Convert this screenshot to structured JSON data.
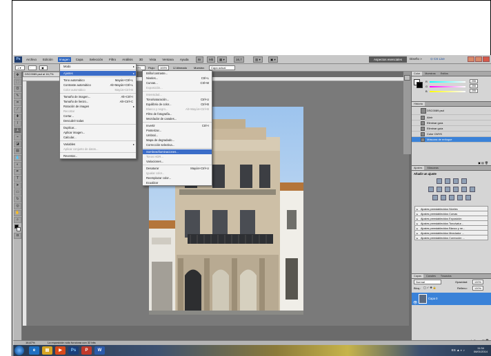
{
  "app": {
    "logo_text": "Ps",
    "menu": [
      "Archivo",
      "Edición",
      "Imagen",
      "Capa",
      "Selección",
      "Filtro",
      "Análisis",
      "3D",
      "Vista",
      "Ventana",
      "Ayuda"
    ],
    "active_menu": "Imagen",
    "zoom_box": "16,7",
    "workspace_button": "Aspectos esenciales",
    "workspace_design": "Diseño",
    "more": "»",
    "cslive": "CS Live"
  },
  "options": {
    "zoom_field": "100%",
    "flujo_label": "Flujo:",
    "flujo_value": "100%",
    "alinear_label": "Alineado",
    "muestra_label": "Muestra:",
    "muestra_value": "Capa actual"
  },
  "doc": {
    "tab": "DSC0089.psd al 16,7%"
  },
  "imagen_menu": {
    "items": [
      {
        "label": "Modo",
        "shortcut": "",
        "arrow": true,
        "disabled": false,
        "sep_after": true
      },
      {
        "label": "Ajustes",
        "shortcut": "",
        "arrow": true,
        "disabled": false,
        "highlight": true,
        "sep_after": true
      },
      {
        "label": "Tono automático",
        "shortcut": "Mayús+Ctrl+L",
        "disabled": false
      },
      {
        "label": "Contraste automático",
        "shortcut": "Alt+Mayús+Ctrl+L",
        "disabled": false
      },
      {
        "label": "Color automático",
        "shortcut": "Mayús+Ctrl+B",
        "disabled": true,
        "sep_after": true
      },
      {
        "label": "Tamaño de imagen...",
        "shortcut": "Alt+Ctrl+I",
        "disabled": false
      },
      {
        "label": "Tamaño de lienzo...",
        "shortcut": "Alt+Ctrl+C",
        "disabled": false
      },
      {
        "label": "Rotación de imagen",
        "shortcut": "",
        "arrow": true,
        "disabled": false
      },
      {
        "label": "Recortar",
        "shortcut": "",
        "disabled": true
      },
      {
        "label": "Cortar...",
        "shortcut": "",
        "disabled": false
      },
      {
        "label": "Descubrir todas",
        "shortcut": "",
        "disabled": false,
        "sep_after": true
      },
      {
        "label": "Duplicar...",
        "shortcut": "",
        "disabled": false
      },
      {
        "label": "Aplicar imagen...",
        "shortcut": "",
        "disabled": false
      },
      {
        "label": "Calcular...",
        "shortcut": "",
        "disabled": false,
        "sep_after": true
      },
      {
        "label": "Variables",
        "shortcut": "",
        "arrow": true,
        "disabled": false
      },
      {
        "label": "Aplicar conjunto de datos...",
        "shortcut": "",
        "disabled": true,
        "sep_after": true
      },
      {
        "label": "Reventar...",
        "shortcut": "",
        "disabled": false
      }
    ]
  },
  "ajustes_menu": {
    "items": [
      {
        "label": "Brillo/contraste...",
        "shortcut": "",
        "disabled": false
      },
      {
        "label": "Niveles...",
        "shortcut": "Ctrl+L",
        "disabled": false
      },
      {
        "label": "Curvas...",
        "shortcut": "Ctrl+M",
        "disabled": false
      },
      {
        "label": "Exposición...",
        "shortcut": "",
        "disabled": true,
        "sep_after": true
      },
      {
        "label": "Intensidad...",
        "shortcut": "",
        "disabled": true
      },
      {
        "label": "Tono/saturación...",
        "shortcut": "Ctrl+U",
        "disabled": false
      },
      {
        "label": "Equilibrio de color...",
        "shortcut": "Ctrl+B",
        "disabled": false
      },
      {
        "label": "Blanco y negro...",
        "shortcut": "Alt+Mayús+Ctrl+B",
        "disabled": true
      },
      {
        "label": "Filtro de fotografía...",
        "shortcut": "",
        "disabled": false
      },
      {
        "label": "Mezclador de canales...",
        "shortcut": "",
        "disabled": false,
        "sep_after": true
      },
      {
        "label": "Invertir",
        "shortcut": "Ctrl+I",
        "disabled": false
      },
      {
        "label": "Posterizar...",
        "shortcut": "",
        "disabled": false
      },
      {
        "label": "Umbral...",
        "shortcut": "",
        "disabled": false
      },
      {
        "label": "Mapa de degradado...",
        "shortcut": "",
        "disabled": false
      },
      {
        "label": "Corrección selectiva...",
        "shortcut": "",
        "disabled": false,
        "sep_after": true
      },
      {
        "label": "Sombras/iluminaciones...",
        "shortcut": "",
        "disabled": false,
        "highlight": true
      },
      {
        "label": "Tonos HDR...",
        "shortcut": "",
        "disabled": true
      },
      {
        "label": "Variaciones...",
        "shortcut": "",
        "disabled": false,
        "sep_after": true
      },
      {
        "label": "Desaturar",
        "shortcut": "Mayús+Ctrl+U",
        "disabled": false
      },
      {
        "label": "Igualar color...",
        "shortcut": "",
        "disabled": true
      },
      {
        "label": "Reemplazar color...",
        "shortcut": "",
        "disabled": false
      },
      {
        "label": "Ecualizar",
        "shortcut": "",
        "disabled": false
      }
    ]
  },
  "color_panel": {
    "tabs": [
      "Color",
      "Muestras",
      "Estilos"
    ],
    "rows": [
      {
        "label": "R",
        "value": "255"
      },
      {
        "label": "G",
        "value": "255"
      },
      {
        "label": "B",
        "value": "255"
      }
    ]
  },
  "history_panel": {
    "tabs": [
      "Historia"
    ],
    "snapshot": "DSC0089.psd",
    "items": [
      "Abrir",
      "Eliminar guía",
      "Eliminar guía",
      "Color CMYK",
      "Máscara de enfoque"
    ],
    "selected": 4
  },
  "adjust_panel": {
    "tabs": [
      "Ajustes",
      "Máscaras"
    ],
    "title": "Añadir un ajuste",
    "presets": [
      "Ajustes preestablecidos Niveles",
      "Ajustes preestablecidos Curvas",
      "Ajustes preestablecidos Exposición",
      "Ajustes preestablecidos Tono/satur...",
      "Ajustes preestablecidos Blanco y ne...",
      "Ajustes preestablecidos Mezclador ...",
      "Ajustes preestablecidos Corrección ..."
    ]
  },
  "layers_panel": {
    "tabs": [
      "Capas",
      "Canales",
      "Trazados"
    ],
    "blend": "Normal",
    "opacity_label": "Opacidad:",
    "opacity": "100%",
    "lock_label": "Bloq.:",
    "fill_label": "Relleno:",
    "fill": "100%",
    "layer_name": "Capa 0"
  },
  "status": {
    "zoom": "16,67%",
    "message": "La exposición sólo funciona con 32 bits"
  },
  "taskbar": {
    "time": "11:34",
    "date": "06/01/2014",
    "lang": "ES"
  },
  "colors": {
    "highlight": "#3a6cc8",
    "selected_row": "#3a82d8",
    "workspace_bg": "#6b6b6b"
  }
}
